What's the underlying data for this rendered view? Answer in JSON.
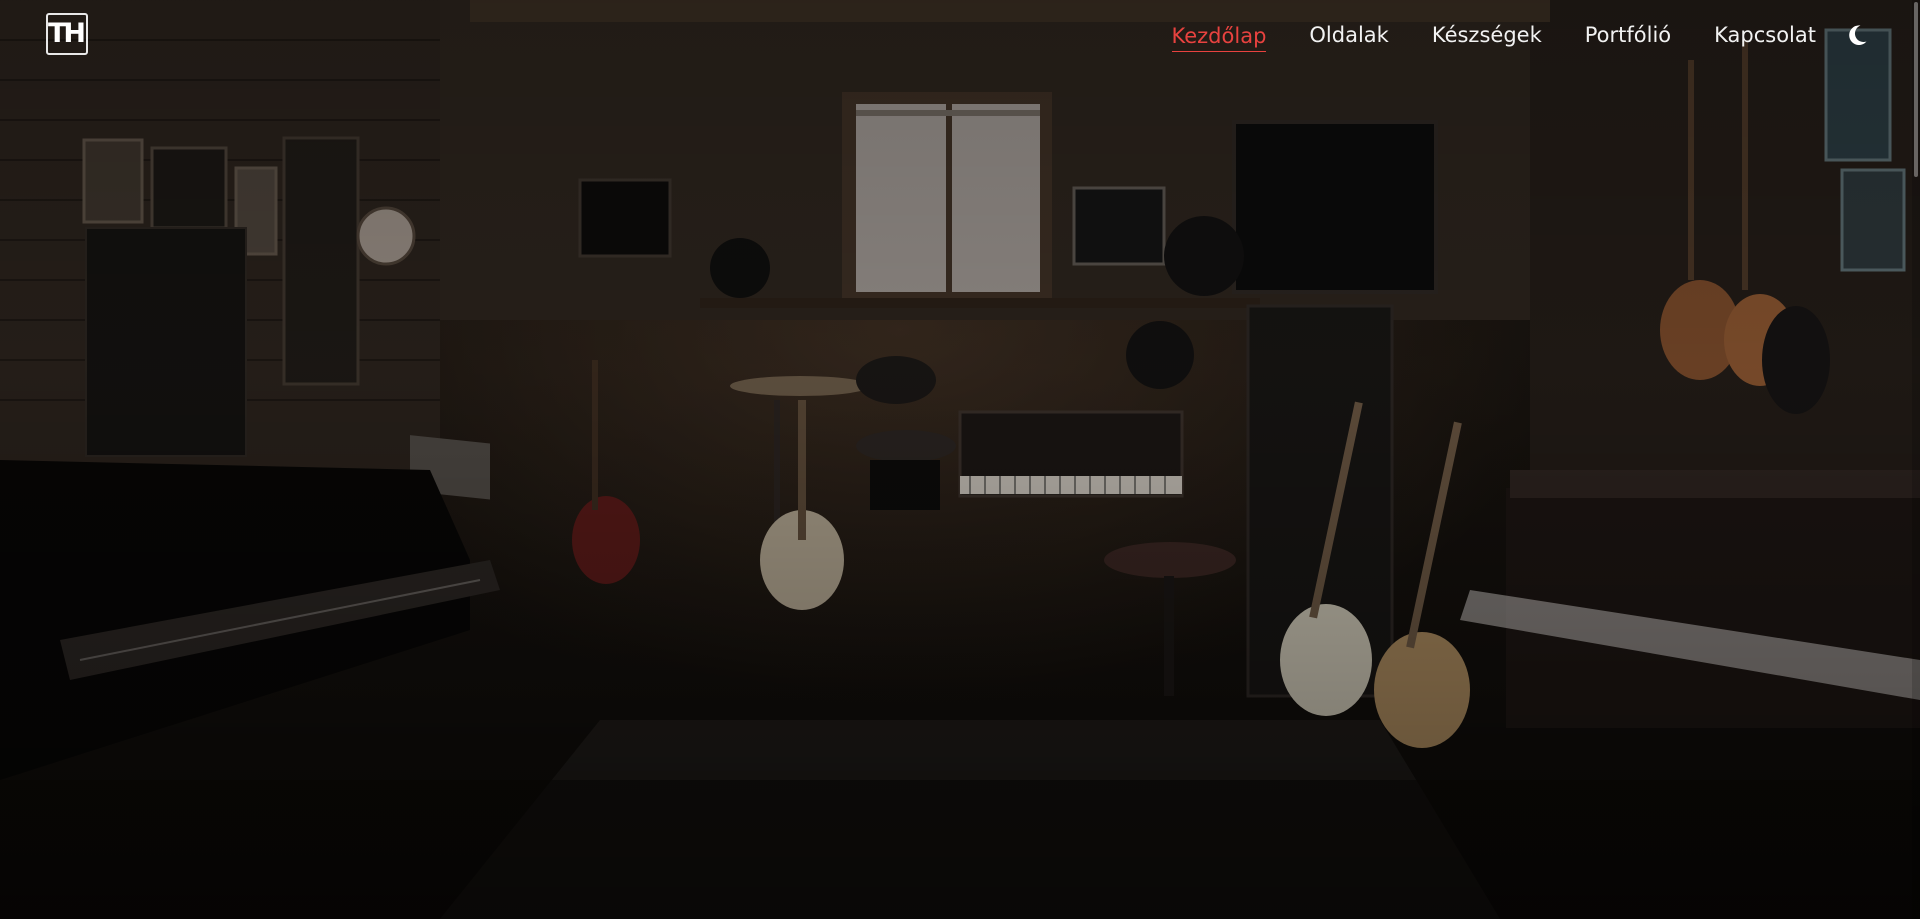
{
  "brand": {
    "logo_text": "TH"
  },
  "nav": {
    "items": [
      {
        "label": "Kezdőlap",
        "active": true
      },
      {
        "label": "Oldalak",
        "active": false
      },
      {
        "label": "Készségek",
        "active": false
      },
      {
        "label": "Portfólió",
        "active": false
      },
      {
        "label": "Kapcsolat",
        "active": false
      }
    ],
    "theme_toggle_icon": "moon-icon"
  },
  "hero": {
    "background_icon": "music-studio-image"
  },
  "colors": {
    "accent": "#e8423f",
    "nav_text": "#f2f2f2"
  }
}
